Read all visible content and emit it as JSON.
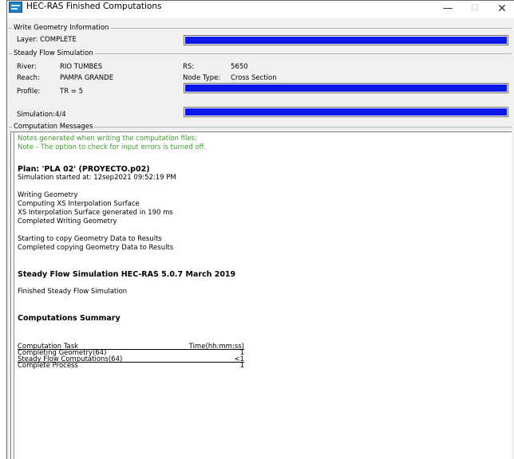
{
  "window": {
    "title": "HEC-RAS Finished Computations",
    "min_glyph": "—",
    "max_glyph": "☐",
    "close_glyph": "✕"
  },
  "write_geometry": {
    "group_label": "Write Geometry Information",
    "layer_label": "Layer: COMPLETE",
    "progress": 1.0
  },
  "steady_flow": {
    "group_label": "Steady Flow Simulation",
    "river_label": "River:",
    "river_value": "RIO TUMBES",
    "reach_label": "Reach:",
    "reach_value": "PAMPA GRANDE",
    "rs_label": "RS:",
    "rs_value": "5650",
    "node_type_label": "Node Type:",
    "node_type_value": "Cross Section",
    "profile_label": "Profile:",
    "profile_value": "TR = 5",
    "profile_progress": 1.0,
    "simulation_label": "Simulation:",
    "simulation_value": "4/4",
    "simulation_progress": 1.0
  },
  "computation_messages": {
    "group_label": "Computation Messages",
    "notes": [
      "Notes generated when writing the computation files:",
      "Note - The option to check for input errors is turned off."
    ],
    "plan_title": "Plan: 'PLA 02' (PROYECTO.p02)",
    "sim_started": "Simulation started at: 12sep2021 09:52:19 PM",
    "geometry_lines": [
      "Writing Geometry",
      "Computing XS Interpolation Surface",
      "XS Interpolation Surface generated in 190 ms",
      "Completed Writing Geometry"
    ],
    "copy_lines": [
      "Starting to copy Geometry Data to Results",
      "Completed copying Geometry Data to Results"
    ],
    "steady_heading": "Steady Flow Simulation HEC-RAS 5.0.7 March 2019",
    "finished_line": "Finished Steady Flow Simulation",
    "summary_heading": "Computations Summary",
    "summary_header": {
      "task": "Computation Task",
      "time": "Time(hh:mm:ss)"
    },
    "summary_rows": [
      {
        "task": "Completing Geometry(64)",
        "time": "1"
      },
      {
        "task": "Steady Flow Computations(64)",
        "time": "<1"
      },
      {
        "task": "Complete Process",
        "time": "1"
      }
    ]
  }
}
